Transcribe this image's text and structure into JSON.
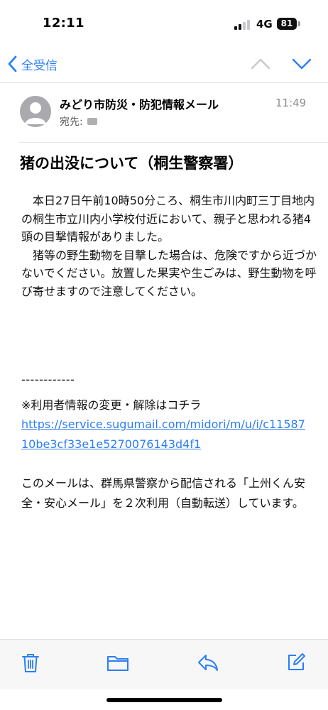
{
  "status": {
    "time": "12:11",
    "network": "4G",
    "battery": "81"
  },
  "nav": {
    "back_label": "全受信"
  },
  "message": {
    "sender": "みどり市防災・防犯情報メール",
    "time": "11:49",
    "to_label": "宛先:",
    "subject": "猪の出没について（桐生警察署）",
    "body_paragraphs": [
      "　本日27日午前10時50分ころ、桐生市川内町三丁目地内の桐生市立川内小学校付近において、親子と思われる猪4頭の目撃情報がありました。",
      "　猪等の野生動物を目撃した場合は、危険ですから近づかないでください。放置した果実や生ごみは、野生動物を呼び寄せますので注意してください。"
    ],
    "divider": "------------",
    "unsubscribe_text": "※利用者情報の変更・解除はコチラ",
    "link": "https://service.sugumail.com/midori/m/u/i/c1158710be3cf33e1e5270076143d4f1",
    "footer": "このメールは、群馬県警察から配信される「上州くん安全・安心メール」を２次利用（自動転送）しています。"
  },
  "toolbar": {
    "icons": [
      "trash-icon",
      "folder-icon",
      "reply-icon",
      "compose-icon"
    ]
  },
  "colors": {
    "accent": "#2b7ef6",
    "muted": "#8e8e93"
  }
}
